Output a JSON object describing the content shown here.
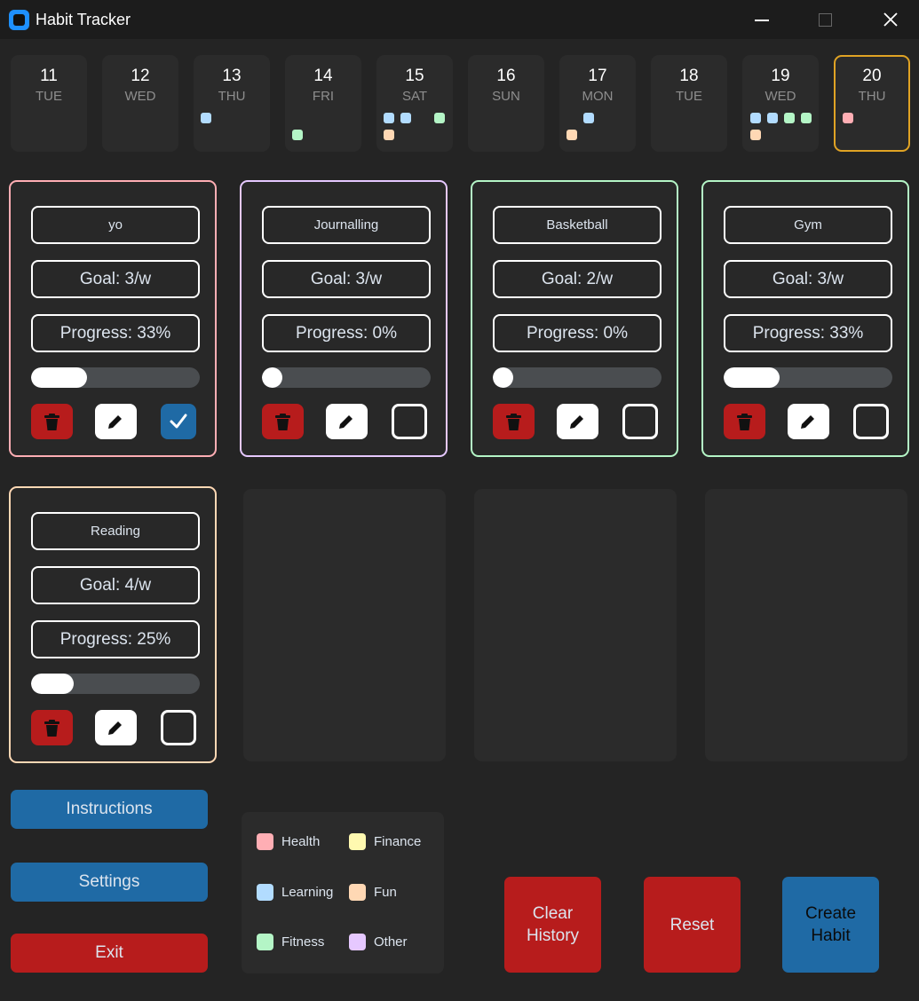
{
  "window": {
    "title": "Habit Tracker"
  },
  "colors": {
    "health": "#ffaeb4",
    "learning": "#b2dcff",
    "fitness": "#b4f5c6",
    "finance": "#fff9b0",
    "fun": "#ffd8b4",
    "other": "#e6c8ff",
    "today_border": "#e0a324",
    "button_blue": "#1f6aa5",
    "button_red": "#b71c1c"
  },
  "calendar": [
    {
      "num": "11",
      "name": "TUE",
      "dots": []
    },
    {
      "num": "12",
      "name": "WED",
      "dots": []
    },
    {
      "num": "13",
      "name": "THU",
      "dots": [
        "learning"
      ]
    },
    {
      "num": "14",
      "name": "FRI",
      "dots": [
        "fitness"
      ]
    },
    {
      "num": "15",
      "name": "SAT",
      "dots": [
        "learning",
        "learning",
        "fitness",
        "fun"
      ]
    },
    {
      "num": "16",
      "name": "SUN",
      "dots": []
    },
    {
      "num": "17",
      "name": "MON",
      "dots": [
        "learning",
        "fun"
      ]
    },
    {
      "num": "18",
      "name": "TUE",
      "dots": []
    },
    {
      "num": "19",
      "name": "WED",
      "dots": [
        "learning",
        "learning",
        "fitness",
        "fitness",
        "fun"
      ]
    },
    {
      "num": "20",
      "name": "THU",
      "dots": [
        "health"
      ],
      "today": true
    }
  ],
  "habits": [
    {
      "name": "yo",
      "goal": "Goal: 3/w",
      "progress": "Progress: 33%",
      "progress_value": 0.33,
      "category": "health",
      "checked": true
    },
    {
      "name": "Journalling",
      "goal": "Goal: 3/w",
      "progress": "Progress: 0%",
      "progress_value": 0,
      "category": "other",
      "checked": false
    },
    {
      "name": "Basketball",
      "goal": "Goal: 2/w",
      "progress": "Progress: 0%",
      "progress_value": 0,
      "category": "fitness",
      "checked": false
    },
    {
      "name": "Gym",
      "goal": "Goal: 3/w",
      "progress": "Progress: 33%",
      "progress_value": 0.33,
      "category": "fitness",
      "checked": false
    },
    {
      "name": "Reading",
      "goal": "Goal: 4/w",
      "progress": "Progress: 25%",
      "progress_value": 0.25,
      "category": "fun",
      "checked": false
    }
  ],
  "icons": {
    "delete": "trash-icon",
    "edit": "pencil-icon",
    "check": "checkmark-icon"
  },
  "sidebar": {
    "instructions": "Instructions",
    "settings": "Settings",
    "exit": "Exit"
  },
  "legend": [
    {
      "label": "Health",
      "category": "health"
    },
    {
      "label": "Finance",
      "category": "finance"
    },
    {
      "label": "Learning",
      "category": "learning"
    },
    {
      "label": "Fun",
      "category": "fun"
    },
    {
      "label": "Fitness",
      "category": "fitness"
    },
    {
      "label": "Other",
      "category": "other"
    }
  ],
  "actions": {
    "clear_history": "Clear History",
    "reset": "Reset",
    "create_habit": "Create Habit"
  }
}
